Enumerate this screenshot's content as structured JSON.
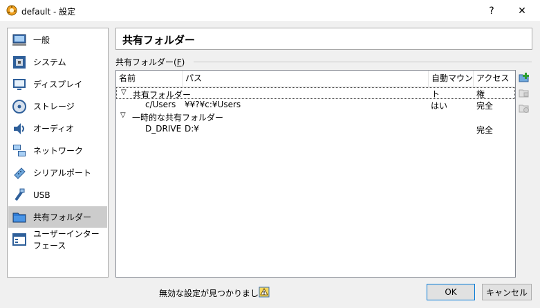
{
  "window": {
    "title": "default - 設定",
    "help": "?",
    "close": "✕"
  },
  "sidebar": {
    "items": [
      {
        "label": "一般",
        "icon": "monitor-icon"
      },
      {
        "label": "システム",
        "icon": "chip-icon"
      },
      {
        "label": "ディスプレイ",
        "icon": "display-icon"
      },
      {
        "label": "ストレージ",
        "icon": "disk-icon"
      },
      {
        "label": "オーディオ",
        "icon": "speaker-icon"
      },
      {
        "label": "ネットワーク",
        "icon": "network-icon"
      },
      {
        "label": "シリアルポート",
        "icon": "serial-port-icon"
      },
      {
        "label": "USB",
        "icon": "usb-icon"
      },
      {
        "label": "共有フォルダー",
        "icon": "folder-icon",
        "active": true
      },
      {
        "label": "ユーザーインターフェース",
        "icon": "ui-window-icon"
      }
    ]
  },
  "main": {
    "header": "共有フォルダー",
    "group_label": "共有フォルダー(F)",
    "group_label_prefix": "共有フォルダー(",
    "group_label_accel": "F",
    "group_label_suffix": ")",
    "columns": [
      "名前",
      "パス",
      "自動マウント",
      "アクセス権"
    ],
    "groups": [
      {
        "name": "共有フォルダー",
        "rows": [
          {
            "name": "c/Users",
            "path": "¥¥?¥c:¥Users",
            "auto": "はい",
            "access": "完全"
          }
        ]
      },
      {
        "name": "一時的な共有フォルダー",
        "rows": [
          {
            "name": "D_DRIVE",
            "path": "D:¥",
            "auto": "",
            "access": "完全"
          }
        ]
      }
    ]
  },
  "footer": {
    "status": "無効な設定が見つかりました",
    "ok": "OK",
    "cancel": "キャンセル"
  },
  "colors": {
    "accent": "#0078d7",
    "selected_bg": "#cccccc",
    "add_green": "#2e9e2e"
  }
}
